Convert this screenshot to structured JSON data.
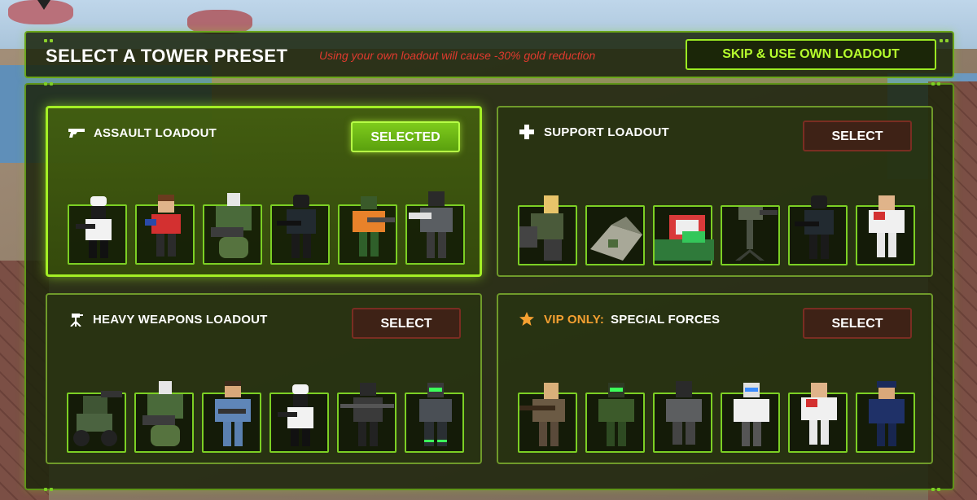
{
  "header": {
    "title": "SELECT A TOWER PRESET",
    "warning": "Using your own loadout will cause -30% gold reduction",
    "skip_label": "SKIP & USE OWN LOADOUT"
  },
  "loadouts": [
    {
      "title": "ASSAULT LOADOUT",
      "vip_prefix": "",
      "icon": "pistol-icon",
      "button": "SELECTED",
      "selected": true,
      "towers": [
        "chef-gunner",
        "red-shirt-boy",
        "green-armored-minigunner",
        "black-ops-soldier",
        "orange-shirt-soldier",
        "gray-armored-soldier"
      ]
    },
    {
      "title": "SUPPORT LOADOUT",
      "vip_prefix": "",
      "icon": "medical-cross-icon",
      "button": "SELECT",
      "selected": false,
      "towers": [
        "blonde-soldier",
        "military-tent",
        "supply-crate",
        "sentry-turret",
        "black-ops-soldier",
        "medic"
      ]
    },
    {
      "title": "HEAVY WEAPONS LOADOUT",
      "vip_prefix": "",
      "icon": "tripod-turret-icon",
      "button": "SELECT",
      "selected": false,
      "towers": [
        "mortar-turret",
        "green-armored-minigunner",
        "blue-scrubs-gunner",
        "chef-gunner",
        "black-sniper",
        "green-tech-soldier"
      ]
    },
    {
      "title": "SPECIAL FORCES",
      "vip_prefix": "VIP ONLY:",
      "icon": "star-icon",
      "button": "SELECT",
      "selected": false,
      "towers": [
        "rifle-soldier",
        "camo-soldier",
        "gray-soldier",
        "white-tech-soldier",
        "medic",
        "navy-officer"
      ]
    }
  ],
  "colors": {
    "accent": "#9bea22",
    "warning": "#e03a2e",
    "vip": "#f5a031",
    "select_button": "#3e2216"
  }
}
